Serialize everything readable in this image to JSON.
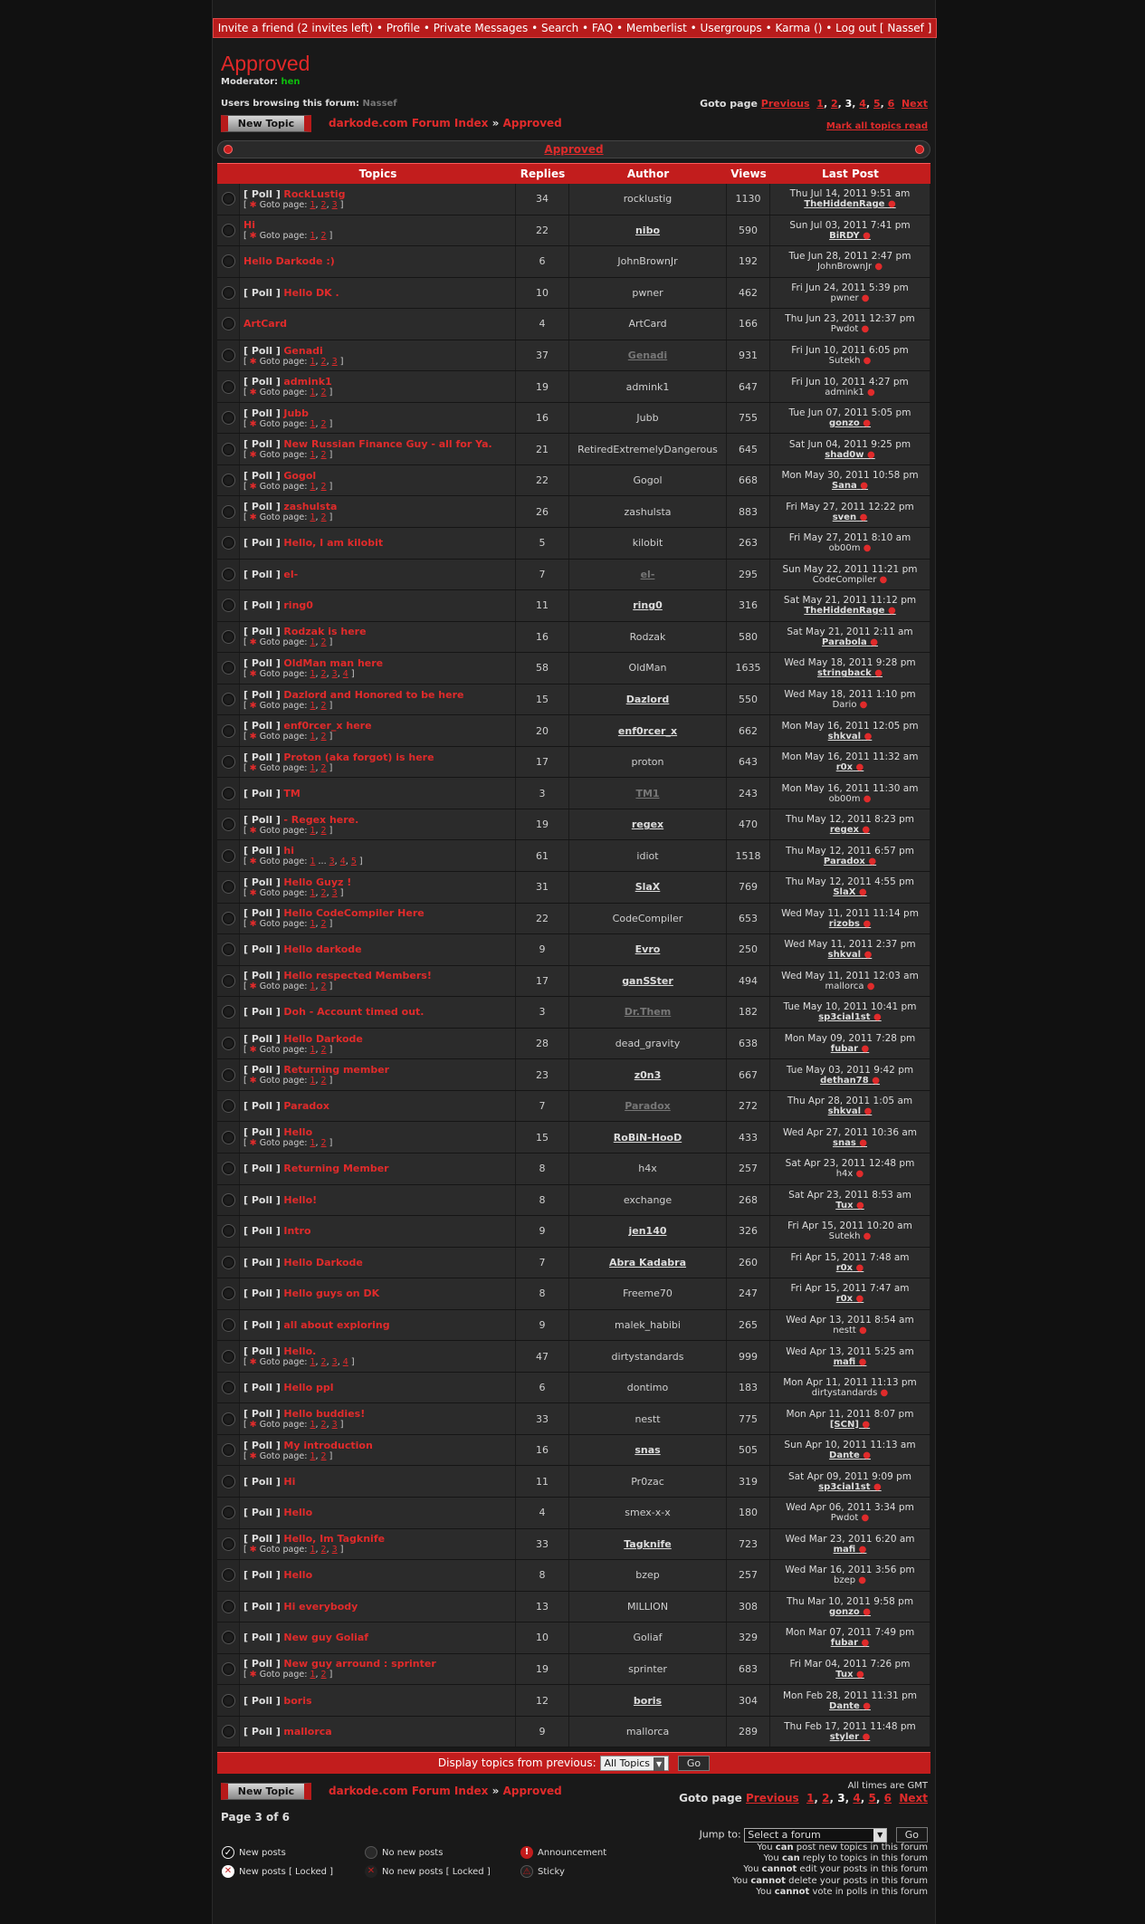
{
  "topbar": {
    "links": "Invite a friend (2 invites left) • Profile • Private Messages • Search • FAQ • Memberlist • Usergroups • Karma () • Log out [ Nassef ]"
  },
  "forum": {
    "title": "Approved",
    "moderator_label": "Moderator:",
    "moderator": "hen",
    "browsing_label": "Users browsing this forum:",
    "browsing_user": "Nassef",
    "new_topic": "New Topic",
    "index_link": "darkode.com Forum Index",
    "crumb_sep": "»",
    "crumb_current": "Approved",
    "mark_all": "Mark all topics read",
    "category": "Approved"
  },
  "goto": {
    "label": "Goto page",
    "prev": "Previous",
    "p1": "1",
    "p2": "2",
    "p3": "3",
    "p4": "4",
    "p5": "5",
    "p6": "6",
    "next": "Next"
  },
  "headers": {
    "topics": "Topics",
    "replies": "Replies",
    "author": "Author",
    "views": "Views",
    "last_post": "Last Post"
  },
  "topics": [
    {
      "poll": true,
      "title": "RockLustig",
      "pages": [
        "1",
        "2",
        "3"
      ],
      "replies": "34",
      "author": "rocklustig",
      "as": "n",
      "views": "1130",
      "date": "Thu Jul 14, 2011 9:51 am",
      "last": "TheHiddenRage",
      "ls": "b"
    },
    {
      "poll": false,
      "title": "Hi",
      "pages": [
        "1",
        "2"
      ],
      "replies": "22",
      "author": "nibo",
      "as": "b",
      "views": "590",
      "date": "Sun Jul 03, 2011 7:41 pm",
      "last": "BiRDY",
      "ls": "b"
    },
    {
      "poll": false,
      "title": "Hello Darkode :)",
      "pages": [],
      "replies": "6",
      "author": "JohnBrownJr",
      "as": "n",
      "views": "192",
      "date": "Tue Jun 28, 2011 2:47 pm",
      "last": "JohnBrownJr",
      "ls": "n"
    },
    {
      "poll": true,
      "title": "Hello DK .",
      "pages": [],
      "replies": "10",
      "author": "pwner",
      "as": "n",
      "views": "462",
      "date": "Fri Jun 24, 2011 5:39 pm",
      "last": "pwner",
      "ls": "n"
    },
    {
      "poll": false,
      "title": "ArtCard",
      "pages": [],
      "replies": "4",
      "author": "ArtCard",
      "as": "n",
      "views": "166",
      "date": "Thu Jun 23, 2011 12:37 pm",
      "last": "Pwdot",
      "ls": "n"
    },
    {
      "poll": true,
      "title": "Genadi",
      "pages": [
        "1",
        "2",
        "3"
      ],
      "replies": "37",
      "author": "Genadi",
      "as": "g",
      "views": "931",
      "date": "Fri Jun 10, 2011 6:05 pm",
      "last": "Sutekh",
      "ls": "n"
    },
    {
      "poll": true,
      "title": "admink1",
      "pages": [
        "1",
        "2"
      ],
      "replies": "19",
      "author": "admink1",
      "as": "n",
      "views": "647",
      "date": "Fri Jun 10, 2011 4:27 pm",
      "last": "admink1",
      "ls": "n"
    },
    {
      "poll": true,
      "title": "Jubb",
      "pages": [
        "1",
        "2"
      ],
      "replies": "16",
      "author": "Jubb",
      "as": "n",
      "views": "755",
      "date": "Tue Jun 07, 2011 5:05 pm",
      "last": "gonzo",
      "ls": "b"
    },
    {
      "poll": true,
      "title": "New Russian Finance Guy - all for Ya.",
      "pages": [
        "1",
        "2"
      ],
      "replies": "21",
      "author": "RetiredExtremelyDangerous",
      "as": "n",
      "views": "645",
      "date": "Sat Jun 04, 2011 9:25 pm",
      "last": "shad0w",
      "ls": "b"
    },
    {
      "poll": true,
      "title": "Gogol",
      "pages": [
        "1",
        "2"
      ],
      "replies": "22",
      "author": "Gogol",
      "as": "n",
      "views": "668",
      "date": "Mon May 30, 2011 10:58 pm",
      "last": "Sana",
      "ls": "b"
    },
    {
      "poll": true,
      "title": "zashulsta",
      "pages": [
        "1",
        "2"
      ],
      "replies": "26",
      "author": "zashulsta",
      "as": "n",
      "views": "883",
      "date": "Fri May 27, 2011 12:22 pm",
      "last": "sven",
      "ls": "b"
    },
    {
      "poll": true,
      "title": "Hello, I am kilobit",
      "pages": [],
      "replies": "5",
      "author": "kilobit",
      "as": "n",
      "views": "263",
      "date": "Fri May 27, 2011 8:10 am",
      "last": "ob00m",
      "ls": "n"
    },
    {
      "poll": true,
      "title": "el-",
      "pages": [],
      "replies": "7",
      "author": "el-",
      "as": "g",
      "views": "295",
      "date": "Sun May 22, 2011 11:21 pm",
      "last": "CodeCompiler",
      "ls": "n"
    },
    {
      "poll": true,
      "title": "ring0",
      "pages": [],
      "replies": "11",
      "author": "ring0",
      "as": "b",
      "views": "316",
      "date": "Sat May 21, 2011 11:12 pm",
      "last": "TheHiddenRage",
      "ls": "b"
    },
    {
      "poll": true,
      "title": "Rodzak is here",
      "pages": [
        "1",
        "2"
      ],
      "replies": "16",
      "author": "Rodzak",
      "as": "n",
      "views": "580",
      "date": "Sat May 21, 2011 2:11 am",
      "last": "Parabola",
      "ls": "b"
    },
    {
      "poll": true,
      "title": "OldMan man here",
      "pages": [
        "1",
        "2",
        "3",
        "4"
      ],
      "replies": "58",
      "author": "OldMan",
      "as": "n",
      "views": "1635",
      "date": "Wed May 18, 2011 9:28 pm",
      "last": "stringback",
      "ls": "b"
    },
    {
      "poll": true,
      "title": "Dazlord and Honored to be here",
      "pages": [
        "1",
        "2"
      ],
      "replies": "15",
      "author": "Dazlord",
      "as": "b",
      "views": "550",
      "date": "Wed May 18, 2011 1:10 pm",
      "last": "Dario",
      "ls": "n"
    },
    {
      "poll": true,
      "title": "enf0rcer_x here",
      "pages": [
        "1",
        "2"
      ],
      "replies": "20",
      "author": "enf0rcer_x",
      "as": "b",
      "views": "662",
      "date": "Mon May 16, 2011 12:05 pm",
      "last": "shkval",
      "ls": "b"
    },
    {
      "poll": true,
      "title": "Proton (aka forgot) is here",
      "pages": [
        "1",
        "2"
      ],
      "replies": "17",
      "author": "proton",
      "as": "n",
      "views": "643",
      "date": "Mon May 16, 2011 11:32 am",
      "last": "r0x",
      "ls": "b"
    },
    {
      "poll": true,
      "title": "TM",
      "pages": [],
      "replies": "3",
      "author": "TM1",
      "as": "g",
      "views": "243",
      "date": "Mon May 16, 2011 11:30 am",
      "last": "ob00m",
      "ls": "n"
    },
    {
      "poll": true,
      "title": "- Regex here.",
      "pages": [
        "1",
        "2"
      ],
      "replies": "19",
      "author": "regex",
      "as": "b",
      "views": "470",
      "date": "Thu May 12, 2011 8:23 pm",
      "last": "regex",
      "ls": "b"
    },
    {
      "poll": true,
      "title": "hi",
      "pages": [
        "1",
        "...",
        "3",
        "4",
        "5"
      ],
      "replies": "61",
      "author": "idiot",
      "as": "n",
      "views": "1518",
      "date": "Thu May 12, 2011 6:57 pm",
      "last": "Paradox",
      "ls": "b"
    },
    {
      "poll": true,
      "title": "Hello Guyz !",
      "pages": [
        "1",
        "2",
        "3"
      ],
      "replies": "31",
      "author": "SlaX",
      "as": "b",
      "views": "769",
      "date": "Thu May 12, 2011 4:55 pm",
      "last": "SlaX",
      "ls": "b"
    },
    {
      "poll": true,
      "title": "Hello CodeCompiler Here",
      "pages": [
        "1",
        "2"
      ],
      "replies": "22",
      "author": "CodeCompiler",
      "as": "n",
      "views": "653",
      "date": "Wed May 11, 2011 11:14 pm",
      "last": "rizobs",
      "ls": "b"
    },
    {
      "poll": true,
      "title": "Hello darkode",
      "pages": [],
      "replies": "9",
      "author": "Evro",
      "as": "b",
      "views": "250",
      "date": "Wed May 11, 2011 2:37 pm",
      "last": "shkval",
      "ls": "b"
    },
    {
      "poll": true,
      "title": "Hello respected Members!",
      "pages": [
        "1",
        "2"
      ],
      "replies": "17",
      "author": "ganSSter",
      "as": "b",
      "views": "494",
      "date": "Wed May 11, 2011 12:03 am",
      "last": "mallorca",
      "ls": "n"
    },
    {
      "poll": true,
      "title": "Doh - Account timed out.",
      "pages": [],
      "replies": "3",
      "author": "Dr.Them",
      "as": "g",
      "views": "182",
      "date": "Tue May 10, 2011 10:41 pm",
      "last": "sp3cial1st",
      "ls": "b"
    },
    {
      "poll": true,
      "title": "Hello Darkode",
      "pages": [
        "1",
        "2"
      ],
      "replies": "28",
      "author": "dead_gravity",
      "as": "n",
      "views": "638",
      "date": "Mon May 09, 2011 7:28 pm",
      "last": "fubar",
      "ls": "b"
    },
    {
      "poll": true,
      "title": "Returning member",
      "pages": [
        "1",
        "2"
      ],
      "replies": "23",
      "author": "z0n3",
      "as": "b",
      "views": "667",
      "date": "Tue May 03, 2011 9:42 pm",
      "last": "dethan78",
      "ls": "b"
    },
    {
      "poll": true,
      "title": "Paradox",
      "pages": [],
      "replies": "7",
      "author": "Paradox",
      "as": "g",
      "views": "272",
      "date": "Thu Apr 28, 2011 1:05 am",
      "last": "shkval",
      "ls": "b"
    },
    {
      "poll": true,
      "title": "Hello",
      "pages": [
        "1",
        "2"
      ],
      "replies": "15",
      "author": "RoBiN-HooD",
      "as": "b",
      "views": "433",
      "date": "Wed Apr 27, 2011 10:36 am",
      "last": "snas",
      "ls": "b"
    },
    {
      "poll": true,
      "title": "Returning Member",
      "pages": [],
      "replies": "8",
      "author": "h4x",
      "as": "n",
      "views": "257",
      "date": "Sat Apr 23, 2011 12:48 pm",
      "last": "h4x",
      "ls": "n"
    },
    {
      "poll": true,
      "title": "Hello!",
      "pages": [],
      "replies": "8",
      "author": "exchange",
      "as": "n",
      "views": "268",
      "date": "Sat Apr 23, 2011 8:53 am",
      "last": "Tux",
      "ls": "b"
    },
    {
      "poll": true,
      "title": "Intro",
      "pages": [],
      "replies": "9",
      "author": "jen140",
      "as": "b",
      "views": "326",
      "date": "Fri Apr 15, 2011 10:20 am",
      "last": "Sutekh",
      "ls": "n"
    },
    {
      "poll": true,
      "title": "Hello Darkode",
      "pages": [],
      "replies": "7",
      "author": "Abra Kadabra",
      "as": "b",
      "views": "260",
      "date": "Fri Apr 15, 2011 7:48 am",
      "last": "r0x",
      "ls": "b"
    },
    {
      "poll": true,
      "title": "Hello guys on DK",
      "pages": [],
      "replies": "8",
      "author": "Freeme70",
      "as": "n",
      "views": "247",
      "date": "Fri Apr 15, 2011 7:47 am",
      "last": "r0x",
      "ls": "b"
    },
    {
      "poll": true,
      "title": "all about exploring",
      "pages": [],
      "replies": "9",
      "author": "malek_habibi",
      "as": "n",
      "views": "265",
      "date": "Wed Apr 13, 2011 8:54 am",
      "last": "nestt",
      "ls": "n"
    },
    {
      "poll": true,
      "title": "Hello.",
      "pages": [
        "1",
        "2",
        "3",
        "4"
      ],
      "replies": "47",
      "author": "dirtystandards",
      "as": "n",
      "views": "999",
      "date": "Wed Apr 13, 2011 5:25 am",
      "last": "mafi",
      "ls": "b"
    },
    {
      "poll": true,
      "title": "Hello ppl",
      "pages": [],
      "replies": "6",
      "author": "dontimo",
      "as": "n",
      "views": "183",
      "date": "Mon Apr 11, 2011 11:13 pm",
      "last": "dirtystandards",
      "ls": "n"
    },
    {
      "poll": true,
      "title": "Hello buddies!",
      "pages": [
        "1",
        "2",
        "3"
      ],
      "replies": "33",
      "author": "nestt",
      "as": "n",
      "views": "775",
      "date": "Mon Apr 11, 2011 8:07 pm",
      "last": "[SCN]",
      "ls": "b"
    },
    {
      "poll": true,
      "title": "My introduction",
      "pages": [
        "1",
        "2"
      ],
      "replies": "16",
      "author": "snas",
      "as": "b",
      "views": "505",
      "date": "Sun Apr 10, 2011 11:13 am",
      "last": "Dante",
      "ls": "b"
    },
    {
      "poll": true,
      "title": "Hi",
      "pages": [],
      "replies": "11",
      "author": "Pr0zac",
      "as": "n",
      "views": "319",
      "date": "Sat Apr 09, 2011 9:09 pm",
      "last": "sp3cial1st",
      "ls": "b"
    },
    {
      "poll": true,
      "title": "Hello",
      "pages": [],
      "replies": "4",
      "author": "smex-x-x",
      "as": "n",
      "views": "180",
      "date": "Wed Apr 06, 2011 3:34 pm",
      "last": "Pwdot",
      "ls": "n"
    },
    {
      "poll": true,
      "title": "Hello, Im Tagknife",
      "pages": [
        "1",
        "2",
        "3"
      ],
      "replies": "33",
      "author": "Tagknife",
      "as": "b",
      "views": "723",
      "date": "Wed Mar 23, 2011 6:20 am",
      "last": "mafi",
      "ls": "b"
    },
    {
      "poll": true,
      "title": "Hello",
      "pages": [],
      "replies": "8",
      "author": "bzep",
      "as": "n",
      "views": "257",
      "date": "Wed Mar 16, 2011 3:56 pm",
      "last": "bzep",
      "ls": "n"
    },
    {
      "poll": true,
      "title": "Hi everybody",
      "pages": [],
      "replies": "13",
      "author": "MILLION",
      "as": "n",
      "views": "308",
      "date": "Thu Mar 10, 2011 9:58 pm",
      "last": "gonzo",
      "ls": "b"
    },
    {
      "poll": true,
      "title": "New guy Goliaf",
      "pages": [],
      "replies": "10",
      "author": "Goliaf",
      "as": "n",
      "views": "329",
      "date": "Mon Mar 07, 2011 7:49 pm",
      "last": "fubar",
      "ls": "b"
    },
    {
      "poll": true,
      "title": "New guy arround : sprinter",
      "pages": [
        "1",
        "2"
      ],
      "replies": "19",
      "author": "sprinter",
      "as": "n",
      "views": "683",
      "date": "Fri Mar 04, 2011 7:26 pm",
      "last": "Tux",
      "ls": "b"
    },
    {
      "poll": true,
      "title": "boris",
      "pages": [],
      "replies": "12",
      "author": "boris",
      "as": "b",
      "views": "304",
      "date": "Mon Feb 28, 2011 11:31 pm",
      "last": "Dante",
      "ls": "b"
    },
    {
      "poll": true,
      "title": "mallorca",
      "pages": [],
      "replies": "9",
      "author": "mallorca",
      "as": "n",
      "views": "289",
      "date": "Thu Feb 17, 2011 11:48 pm",
      "last": "styler",
      "ls": "b"
    }
  ],
  "row_text": {
    "poll": "[ Poll ]",
    "goto_prefix": "[",
    "goto_label": "Goto page:",
    "goto_suffix": "]"
  },
  "bottom": {
    "display_label": "Display topics from previous:",
    "display_value": "All Topics",
    "go": "Go",
    "timezone": "All times are GMT",
    "page_of": "Page 3 of 6",
    "jump_label": "Jump to:",
    "jump_value": "Select a forum",
    "perms": [
      [
        "You ",
        "can",
        " post new topics in this forum"
      ],
      [
        "You ",
        "can",
        " reply to topics in this forum"
      ],
      [
        "You ",
        "cannot",
        " edit your posts in this forum"
      ],
      [
        "You ",
        "cannot",
        " delete your posts in this forum"
      ],
      [
        "You ",
        "cannot",
        " vote in polls in this forum"
      ]
    ]
  },
  "legend": {
    "new_posts": "New posts",
    "no_new_posts": "No new posts",
    "announcement": "Announcement",
    "new_posts_locked": "New posts [ Locked ]",
    "no_new_posts_locked": "No new posts [ Locked ]",
    "sticky": "Sticky"
  },
  "colors": {
    "accent": "#c21d1d",
    "link": "#e02b2b",
    "background": "#191919"
  }
}
